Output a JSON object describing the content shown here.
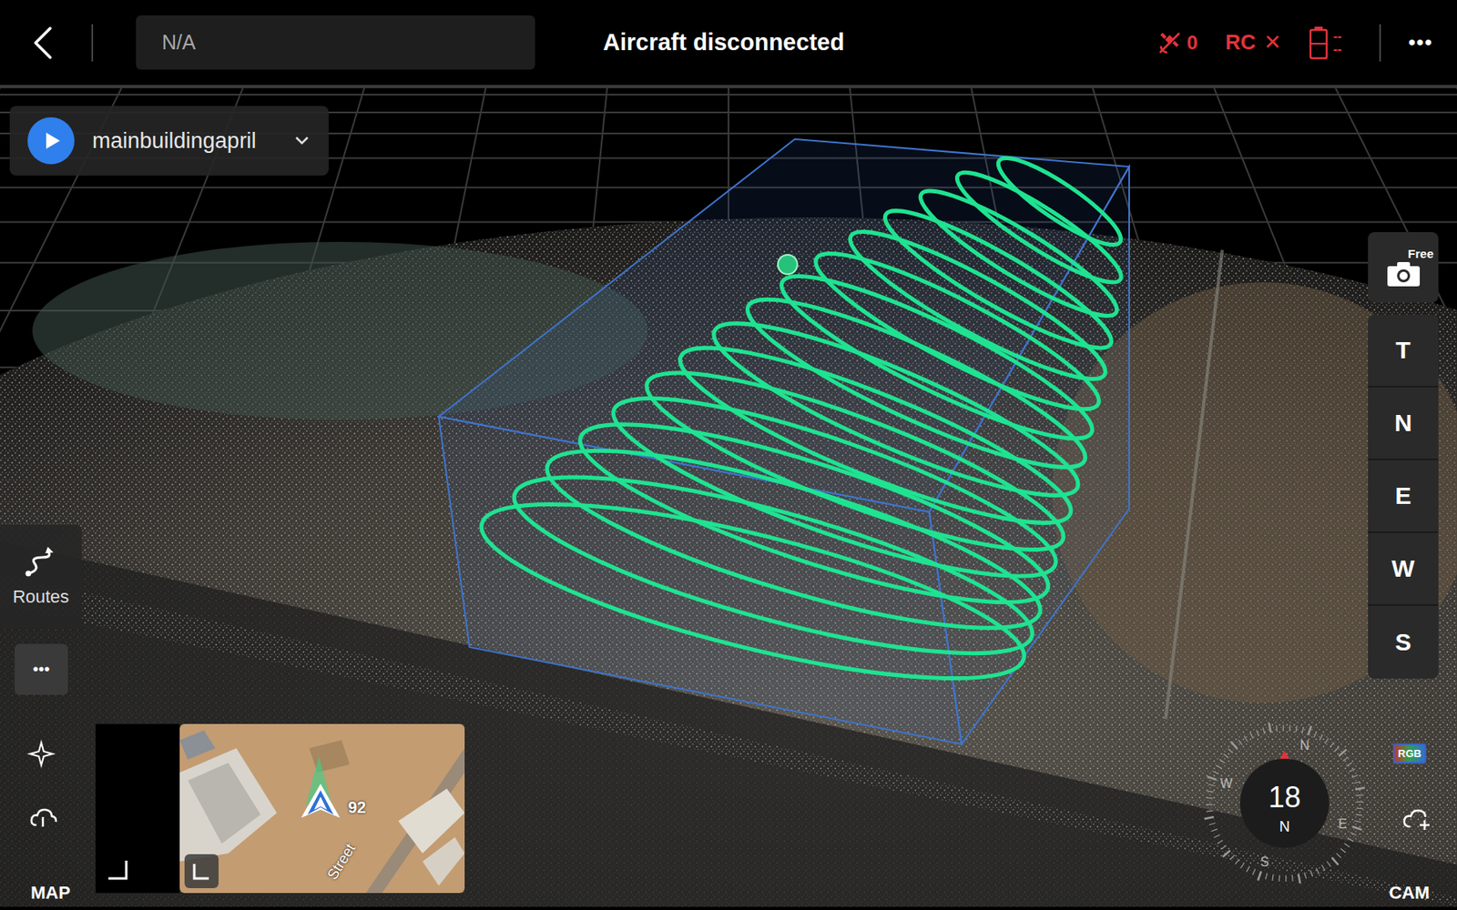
{
  "top_bar": {
    "title": "Aircraft disconnected",
    "field_value": "N/A",
    "satellite_count": "0",
    "rc_label": "RC",
    "rc_status": "✕",
    "battery_readings": [
      "--",
      "--"
    ],
    "menu": "•••"
  },
  "route": {
    "name": "mainbuildingapril"
  },
  "camera": {
    "mode": "Free"
  },
  "view_buttons": [
    {
      "label": "T"
    },
    {
      "label": "N"
    },
    {
      "label": "E"
    },
    {
      "label": "W"
    },
    {
      "label": "S"
    }
  ],
  "left_tools": {
    "routes": "Routes",
    "more": "•••"
  },
  "minimap": {
    "altitude": "92",
    "street": "Street"
  },
  "compass": {
    "heading": "18",
    "direction": "N",
    "rose": [
      "N",
      "E",
      "S",
      "W"
    ]
  },
  "corner_labels": {
    "map": "MAP",
    "cam": "CAM"
  },
  "badge": "RGB"
}
